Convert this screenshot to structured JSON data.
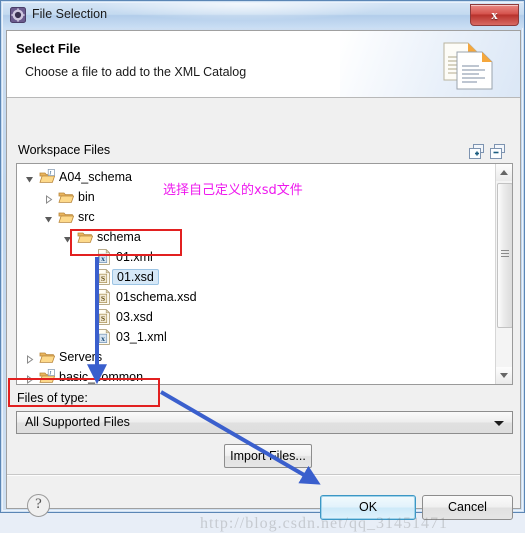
{
  "window": {
    "title": "File Selection",
    "title_icon": "eclipse-gear-icon",
    "close_label": "x"
  },
  "header": {
    "title": "Select File",
    "subtitle": "Choose a file to add to the XML Catalog",
    "banner_icon": "documents-icon"
  },
  "workspace": {
    "label": "Workspace Files",
    "expand_all_icon": "expand-all-icon",
    "collapse_all_icon": "collapse-all-icon",
    "tree": [
      {
        "label": "A04_schema",
        "depth": 0,
        "icon": "java-project-folder-icon",
        "twisty": "expanded",
        "selected": false
      },
      {
        "label": "bin",
        "depth": 1,
        "icon": "folder-icon",
        "twisty": "collapsed",
        "selected": false
      },
      {
        "label": "src",
        "depth": 1,
        "icon": "folder-icon",
        "twisty": "expanded",
        "selected": false
      },
      {
        "label": "schema",
        "depth": 2,
        "icon": "folder-icon",
        "twisty": "expanded",
        "selected": false
      },
      {
        "label": "01.xml",
        "depth": 3,
        "icon": "xml-file-icon",
        "twisty": "none",
        "selected": false
      },
      {
        "label": "01.xsd",
        "depth": 3,
        "icon": "xsd-file-icon",
        "twisty": "none",
        "selected": true
      },
      {
        "label": "01schema.xsd",
        "depth": 3,
        "icon": "xsd-file-icon",
        "twisty": "none",
        "selected": false
      },
      {
        "label": "03.xsd",
        "depth": 3,
        "icon": "xsd-file-icon",
        "twisty": "none",
        "selected": false
      },
      {
        "label": "03_1.xml",
        "depth": 3,
        "icon": "xml-file-icon",
        "twisty": "none",
        "selected": false
      },
      {
        "label": "Servers",
        "depth": 0,
        "icon": "folder-icon",
        "twisty": "collapsed",
        "selected": false
      },
      {
        "label": "basic_common",
        "depth": 0,
        "icon": "java-project-folder-icon",
        "twisty": "collapsed",
        "selected": false
      }
    ]
  },
  "file_type": {
    "label": "Files of type:",
    "selected": "All Supported Files",
    "dropdown_icon": "chevron-down-icon"
  },
  "buttons": {
    "import_files": "Import Files...",
    "ok": "OK",
    "cancel": "Cancel",
    "help": "?"
  },
  "watermark": "http://blog.csdn.net/qq_31451471",
  "annotations": {
    "note_text": "选择自己定义的xsd文件",
    "box_color": "#e22020",
    "arrow_color": "#3a5fcd",
    "note_color": "#ee18ee"
  }
}
